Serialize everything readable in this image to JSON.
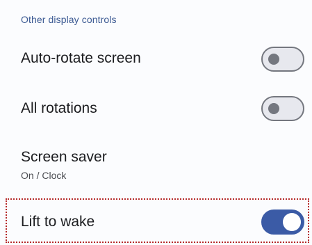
{
  "section": {
    "header": "Other display controls"
  },
  "settings": [
    {
      "title": "Auto-rotate screen",
      "summary": "",
      "toggle": "off"
    },
    {
      "title": "All rotations",
      "summary": "",
      "toggle": "off"
    },
    {
      "title": "Screen saver",
      "summary": "On / Clock",
      "toggle": null
    },
    {
      "title": "Lift to wake",
      "summary": "",
      "toggle": "on"
    }
  ],
  "colors": {
    "accent": "#3b5ba6",
    "section_header": "#3c5a93",
    "highlight_border": "#b52a2a"
  }
}
